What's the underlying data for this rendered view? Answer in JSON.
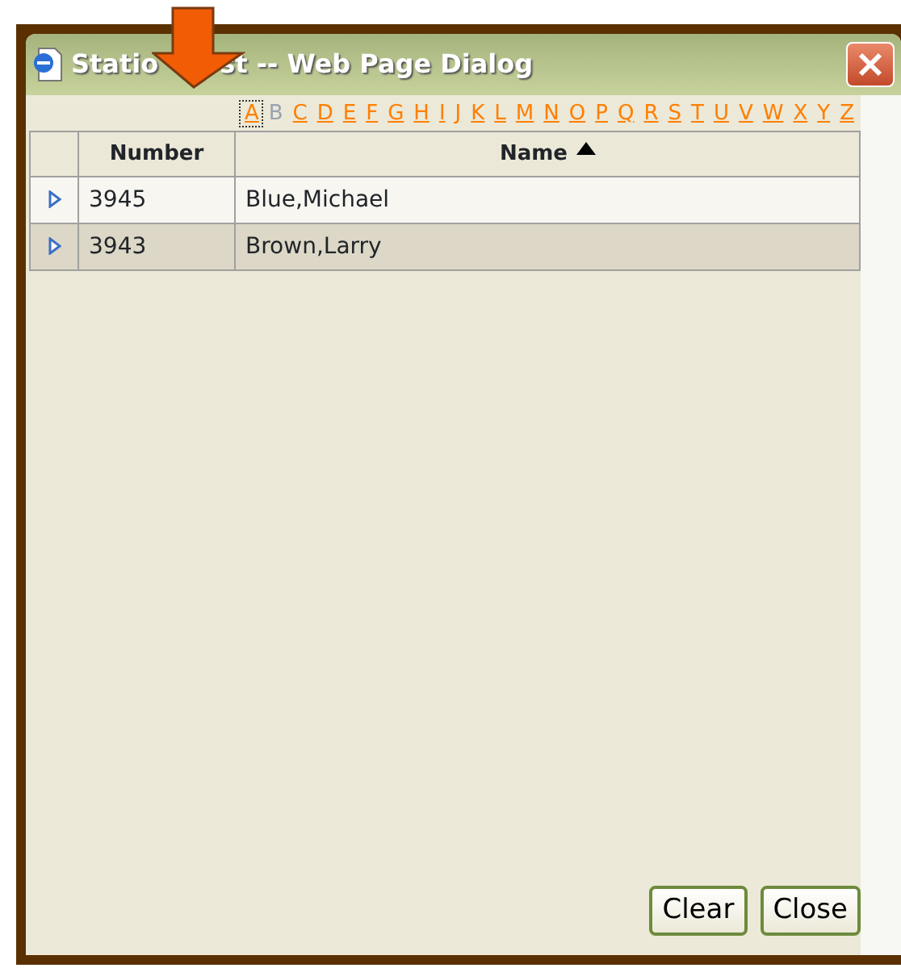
{
  "window": {
    "title_parts": [
      "Statio",
      "st -- Web Page Dialog"
    ]
  },
  "letters": [
    {
      "label": "A",
      "selected": true,
      "disabled": false
    },
    {
      "label": "B",
      "selected": false,
      "disabled": true
    },
    {
      "label": "C",
      "selected": false,
      "disabled": false
    },
    {
      "label": "D",
      "selected": false,
      "disabled": false
    },
    {
      "label": "E",
      "selected": false,
      "disabled": false
    },
    {
      "label": "F",
      "selected": false,
      "disabled": false
    },
    {
      "label": "G",
      "selected": false,
      "disabled": false
    },
    {
      "label": "H",
      "selected": false,
      "disabled": false
    },
    {
      "label": "I",
      "selected": false,
      "disabled": false
    },
    {
      "label": "J",
      "selected": false,
      "disabled": false
    },
    {
      "label": "K",
      "selected": false,
      "disabled": false
    },
    {
      "label": "L",
      "selected": false,
      "disabled": false
    },
    {
      "label": "M",
      "selected": false,
      "disabled": false
    },
    {
      "label": "N",
      "selected": false,
      "disabled": false
    },
    {
      "label": "O",
      "selected": false,
      "disabled": false
    },
    {
      "label": "P",
      "selected": false,
      "disabled": false
    },
    {
      "label": "Q",
      "selected": false,
      "disabled": false
    },
    {
      "label": "R",
      "selected": false,
      "disabled": false
    },
    {
      "label": "S",
      "selected": false,
      "disabled": false
    },
    {
      "label": "T",
      "selected": false,
      "disabled": false
    },
    {
      "label": "U",
      "selected": false,
      "disabled": false
    },
    {
      "label": "V",
      "selected": false,
      "disabled": false
    },
    {
      "label": "W",
      "selected": false,
      "disabled": false
    },
    {
      "label": "X",
      "selected": false,
      "disabled": false
    },
    {
      "label": "Y",
      "selected": false,
      "disabled": false
    },
    {
      "label": "Z",
      "selected": false,
      "disabled": false
    }
  ],
  "table": {
    "columns": [
      {
        "label": "Number",
        "sorted": false
      },
      {
        "label": "Name",
        "sorted": true
      }
    ],
    "rows": [
      {
        "cells": [
          "3945",
          "Blue,Michael"
        ],
        "selected": false
      },
      {
        "cells": [
          "3943",
          "Brown,Larry"
        ],
        "selected": true
      }
    ]
  },
  "buttons": [
    "Clear",
    "Close"
  ]
}
